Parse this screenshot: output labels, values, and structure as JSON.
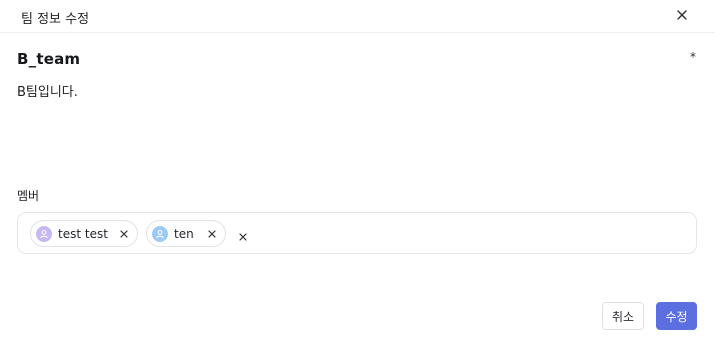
{
  "dialog": {
    "title": "팀 정보 수정",
    "close_icon": "close-icon"
  },
  "team": {
    "name": "B_team",
    "required_mark": "*",
    "description": "B팀입니다."
  },
  "members": {
    "label": "멤버",
    "chips": [
      {
        "name": "test test",
        "avatar_color": "#c7b8f5",
        "avatar_icon": "user-icon",
        "remove_icon": "close-icon"
      },
      {
        "name": "ten",
        "avatar_color": "#9ccaf6",
        "avatar_icon": "user-icon",
        "remove_icon": "close-icon"
      }
    ],
    "clear_icon": "close-icon"
  },
  "footer": {
    "cancel_label": "취소",
    "submit_label": "수정"
  },
  "colors": {
    "primary": "#5c6fe0",
    "border": "#e4e6ea"
  }
}
